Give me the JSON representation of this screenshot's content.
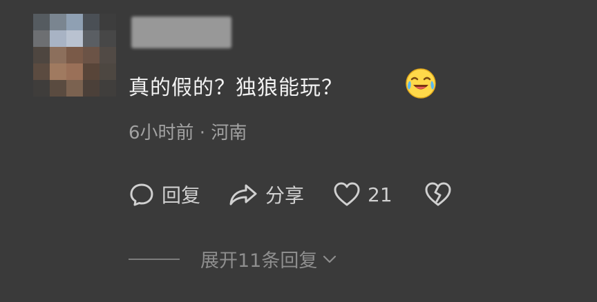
{
  "comment": {
    "text": "真的假的？独狼能玩？",
    "emoji_icon": "crying-laughing-emoji-icon",
    "meta": "6小时前 · 河南"
  },
  "actions": {
    "reply_label": "回复",
    "share_label": "分享",
    "like_count": "21"
  },
  "expand": {
    "label": "展开11条回复"
  },
  "colors": {
    "background": "#3a3a3a",
    "text": "#f2f2f2",
    "meta": "#a2a2a2",
    "action": "#d0d0d0",
    "emoji": "#ffd94a"
  }
}
